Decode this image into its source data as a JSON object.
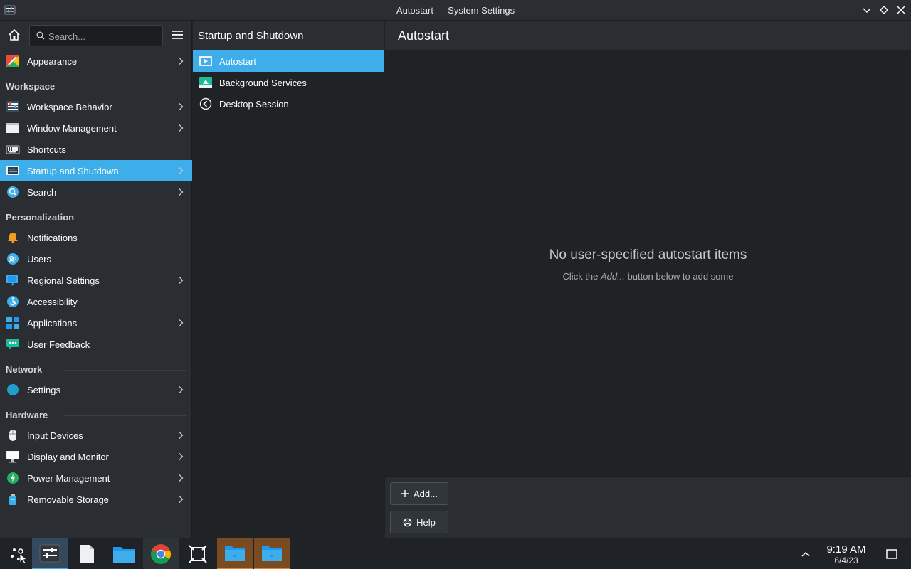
{
  "window": {
    "title": "Autostart — System Settings"
  },
  "search": {
    "placeholder": "Search..."
  },
  "sidebar": {
    "items": [
      {
        "type": "item",
        "label": "Appearance",
        "icon": "appearance-icon",
        "chevron": true
      },
      {
        "type": "header",
        "label": "Workspace"
      },
      {
        "type": "item",
        "label": "Workspace Behavior",
        "icon": "workspace-behavior-icon",
        "chevron": true
      },
      {
        "type": "item",
        "label": "Window Management",
        "icon": "window-management-icon",
        "chevron": true
      },
      {
        "type": "item",
        "label": "Shortcuts",
        "icon": "keyboard-icon",
        "chevron": false
      },
      {
        "type": "item",
        "label": "Startup and Shutdown",
        "icon": "startup-shutdown-icon",
        "chevron": true,
        "active": true
      },
      {
        "type": "item",
        "label": "Search",
        "icon": "search-settings-icon",
        "chevron": true
      },
      {
        "type": "header",
        "label": "Personalization"
      },
      {
        "type": "item",
        "label": "Notifications",
        "icon": "bell-icon",
        "chevron": false
      },
      {
        "type": "item",
        "label": "Users",
        "icon": "users-icon",
        "chevron": false
      },
      {
        "type": "item",
        "label": "Regional Settings",
        "icon": "regional-settings-icon",
        "chevron": true
      },
      {
        "type": "item",
        "label": "Accessibility",
        "icon": "accessibility-icon",
        "chevron": false
      },
      {
        "type": "item",
        "label": "Applications",
        "icon": "applications-icon",
        "chevron": true
      },
      {
        "type": "item",
        "label": "User Feedback",
        "icon": "feedback-icon",
        "chevron": false
      },
      {
        "type": "header",
        "label": "Network"
      },
      {
        "type": "item",
        "label": "Settings",
        "icon": "globe-icon",
        "chevron": true
      },
      {
        "type": "header",
        "label": "Hardware"
      },
      {
        "type": "item",
        "label": "Input Devices",
        "icon": "mouse-icon",
        "chevron": true
      },
      {
        "type": "item",
        "label": "Display and Monitor",
        "icon": "monitor-icon",
        "chevron": true
      },
      {
        "type": "item",
        "label": "Power Management",
        "icon": "power-icon",
        "chevron": true
      },
      {
        "type": "item",
        "label": "Removable Storage",
        "icon": "usb-storage-icon",
        "chevron": true
      }
    ]
  },
  "middle": {
    "title": "Startup and Shutdown",
    "items": [
      {
        "label": "Autostart",
        "icon": "autostart-icon",
        "active": true
      },
      {
        "label": "Background Services",
        "icon": "background-services-icon",
        "active": false
      },
      {
        "label": "Desktop Session",
        "icon": "desktop-session-icon",
        "active": false
      }
    ]
  },
  "content": {
    "title": "Autostart",
    "empty_title": "No user-specified autostart items",
    "empty_sub_before": "Click the ",
    "empty_sub_em": "Add...",
    "empty_sub_after": " button below to add some",
    "add_label": "Add...",
    "help_label": "Help"
  },
  "taskbar": {
    "apps": [
      {
        "name": "application-launcher-icon"
      },
      {
        "name": "system-settings-icon",
        "state": "active"
      },
      {
        "name": "text-file-icon"
      },
      {
        "name": "file-manager-icon"
      },
      {
        "name": "chrome-icon",
        "state": "hover"
      },
      {
        "name": "window-grid-icon"
      },
      {
        "name": "folder-icon",
        "state": "warm"
      },
      {
        "name": "folder-icon",
        "state": "warm"
      }
    ],
    "time": "9:19 AM",
    "date": "6/4/23"
  },
  "colors": {
    "accent": "#3daee9",
    "background": "#202326",
    "panel": "#2a2e32",
    "taskbar_warm": "#e0852e"
  }
}
